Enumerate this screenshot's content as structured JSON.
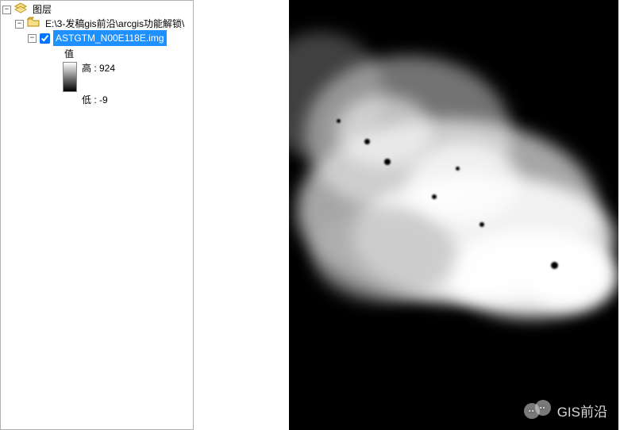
{
  "toc": {
    "root_label": "图层",
    "folder_label": "E:\\3-发稿gis前沿\\arcgis功能解锁\\",
    "layer_label": "ASTGTM_N00E118E.img",
    "layer_checked": true,
    "value_title": "值",
    "high_label": "高 : 924",
    "low_label": "低 : -9"
  },
  "watermark": {
    "text": "GIS前沿"
  },
  "chart_data": {
    "type": "raster-symbology",
    "color_ramp": [
      "#ffffff",
      "#000000"
    ],
    "high_value": 924,
    "low_value": -9,
    "label_high": "高",
    "label_low": "低"
  }
}
